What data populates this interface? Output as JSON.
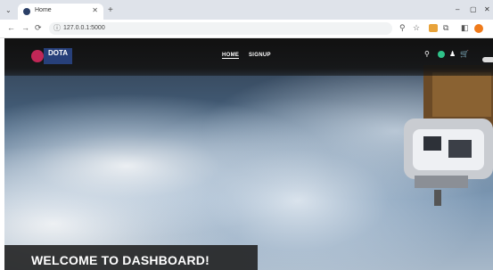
{
  "browser": {
    "tab_title": "Home",
    "tab_close": "✕",
    "new_tab": "+",
    "menu_icon": "⌄",
    "url": "127.0.0.1:5000",
    "window_controls": [
      "–",
      "▢",
      "✕"
    ],
    "nav_icons": [
      "←",
      "→",
      "⟳"
    ],
    "right_icons": [
      "⚲",
      "☆",
      "◧",
      "⧉"
    ]
  },
  "site": {
    "logo_text": "DOTA",
    "nav": [
      {
        "label": "HOME",
        "active": true
      },
      {
        "label": "SIGNUP",
        "active": false
      }
    ],
    "header_icons": [
      "⚲",
      "●",
      "♟",
      "🛒"
    ],
    "hero_title": "WELCOME TO DASHBOARD!"
  }
}
